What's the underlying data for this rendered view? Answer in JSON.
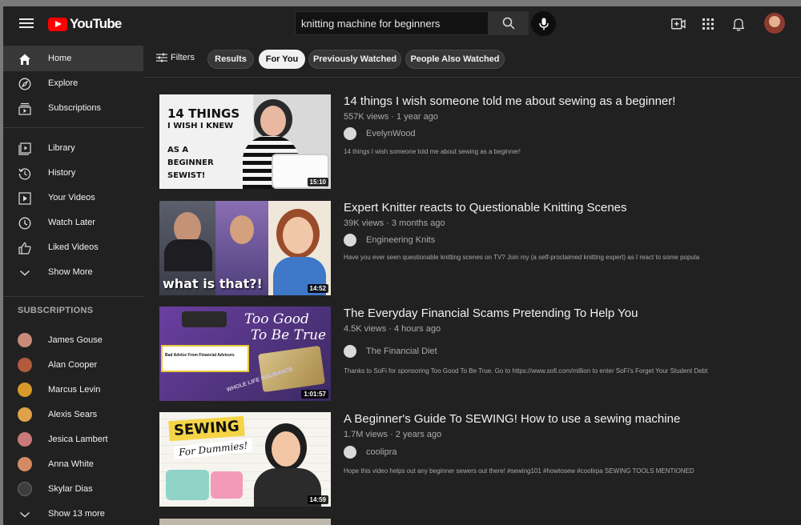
{
  "header": {
    "logo_text": "YouTube",
    "search_value": "knitting machine for beginners"
  },
  "sidebar": {
    "main": [
      {
        "label": "Home",
        "icon": "home-icon",
        "active": true
      },
      {
        "label": "Explore",
        "icon": "compass-icon"
      },
      {
        "label": "Subscriptions",
        "icon": "subscriptions-icon"
      }
    ],
    "library": [
      {
        "label": "Library",
        "icon": "library-icon"
      },
      {
        "label": "History",
        "icon": "history-icon"
      },
      {
        "label": "Your Videos",
        "icon": "play-square-icon"
      },
      {
        "label": "Watch Later",
        "icon": "clock-icon"
      },
      {
        "label": "Liked Videos",
        "icon": "thumbs-up-icon"
      },
      {
        "label": "Show More",
        "icon": "chevron-down-icon"
      }
    ],
    "subscriptions_title": "SUBSCRIPTIONS",
    "subscriptions": [
      {
        "label": "James Gouse",
        "color": "#c98a7a"
      },
      {
        "label": "Alan Cooper",
        "color": "#b25a3c"
      },
      {
        "label": "Marcus Levin",
        "color": "#d79a2a"
      },
      {
        "label": "Alexis Sears",
        "color": "#e0a248"
      },
      {
        "label": "Jesica Lambert",
        "color": "#c97a78"
      },
      {
        "label": "Anna White",
        "color": "#d48a64"
      },
      {
        "label": "Skylar Dias",
        "color": "#3d3d3d"
      }
    ],
    "show_more": "Show 13 more"
  },
  "chips": {
    "filters_label": "Filters",
    "items": [
      {
        "label": "Results",
        "selected": false
      },
      {
        "label": "For You",
        "selected": true
      },
      {
        "label": "Previously Watched",
        "selected": false
      },
      {
        "label": "People Also Watched",
        "selected": false
      }
    ]
  },
  "videos": [
    {
      "title": "14 things I wish someone told me about sewing as a beginner!",
      "meta": "557K views · 1 year ago",
      "channel": "EvelynWood",
      "description": "14 things I wish someone told me about sewing as a beginner!",
      "duration": "15:10",
      "thumb_lines": [
        "14 THINGS",
        "I WISH I KNEW",
        "AS A",
        "BEGINNER",
        "SEWIST!"
      ]
    },
    {
      "title": "Expert Knitter reacts to Questionable Knitting Scenes",
      "meta": "39K views · 3 months ago",
      "channel": "Engineering Knits",
      "description": "Have you ever seen questionable knitting scenes on TV? Join my (a self-proclaimed knitting expert) as I react to some popula",
      "duration": "14:52",
      "thumb_lines": [
        "what is that?!"
      ]
    },
    {
      "title": "The Everyday Financial Scams Pretending To Help You",
      "meta": "4.5K views · 4 hours ago",
      "channel": "The Financial Diet",
      "description": "Thanks to SoFi for sponsoring Too Good To Be True. Go to https://www.sofi.com/million to enter SoFi's Forget Your Student Debt",
      "duration": "1:01:57",
      "thumb_lines": [
        "Too Good",
        "To Be True",
        "Bad Advice From Financial Advisors",
        "WHOLE LIFE INSURANCE"
      ]
    },
    {
      "title": "A Beginner's Guide To SEWING! How to use a sewing machine",
      "meta": "1.7M views · 2 years ago",
      "channel": "coolipra",
      "description": "Hope this video helps out any beginner sewers out there! #sewing101 #howtosew #coolirpa SEWING TOOLS MENTIONED",
      "duration": "14:59",
      "thumb_lines": [
        "SEWING",
        "For Dummies!"
      ]
    }
  ],
  "colors": {
    "background": "#212121",
    "accent_red": "#ff0000",
    "selected_chip": "#f1f1f1"
  }
}
